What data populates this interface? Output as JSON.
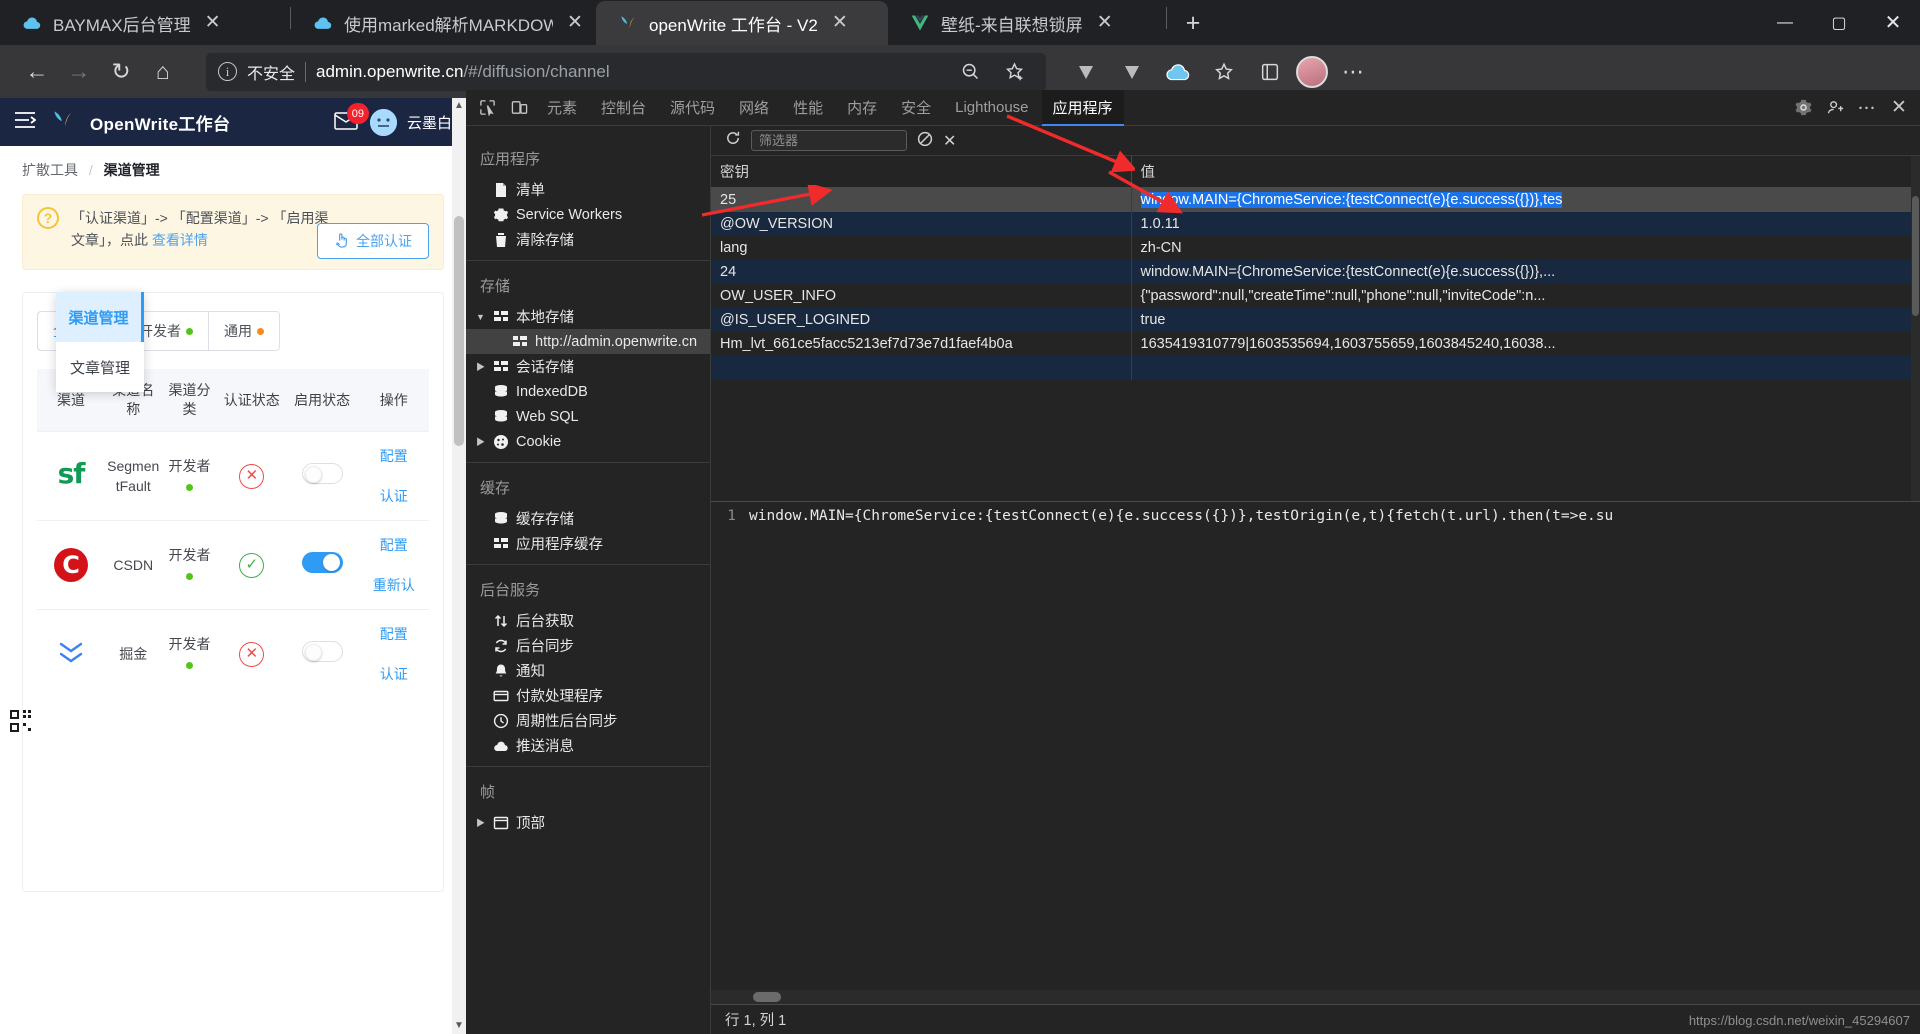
{
  "browser": {
    "tabs": [
      {
        "title": "BAYMAX后台管理",
        "favicon": "cloud-icon",
        "active": false,
        "close_label": "✕"
      },
      {
        "title": "使用marked解析MARKDOWN,生",
        "favicon": "cloud-icon",
        "active": false,
        "close_label": "✕"
      },
      {
        "title": "openWrite 工作台 - V2",
        "favicon": "openwrite-icon",
        "active": true,
        "close_label": "✕"
      },
      {
        "title": "壁纸-来自联想锁屏",
        "favicon": "vue-icon",
        "active": false,
        "close_label": "✕"
      }
    ],
    "new_tab_label": "+",
    "window_controls": {
      "minimize": "—",
      "maximize": "▢",
      "close": "✕"
    },
    "toolbar": {
      "back": "←",
      "forward": "→",
      "reload": "↻",
      "home": "⌂",
      "security_label": "不安全",
      "url_host": "admin.openwrite.cn",
      "url_path": "/#/diffusion/channel",
      "zoom_out_icon": "zoom-out-icon",
      "favorite_icon": "star-add-icon",
      "collections_icon": "collections-icon",
      "settings_icon": "more-icon"
    }
  },
  "app": {
    "header": {
      "menu_icon": "hamburger-icon",
      "logo_icon": "openwrite-logo",
      "title": "OpenWrite工作台",
      "mail_icon": "mail-icon",
      "badge_count": "09",
      "avatar_icon": "user-avatar",
      "user_name": "云墨白"
    },
    "breadcrumb": {
      "parent": "扩散工具",
      "separator": "/",
      "current": "渠道管理"
    },
    "alert": {
      "icon": "question-icon",
      "line1": "「认证渠道」-> 「配置渠道」-> 「启用渠",
      "line2": "文章」，点此",
      "link": "查看详情",
      "button_icon": "hand-click-icon",
      "button_label": "全部认证"
    },
    "dropdown": {
      "items": [
        {
          "label": "渠道管理",
          "active": true
        },
        {
          "label": "文章管理",
          "active": false
        }
      ]
    },
    "tabs": [
      {
        "label": "全部渠道",
        "active": true,
        "dot": null
      },
      {
        "label": "开发者",
        "active": false,
        "dot": "#52c41a"
      },
      {
        "label": "通用",
        "active": false,
        "dot": "#fa8c16"
      }
    ],
    "table": {
      "columns": [
        "渠道",
        "渠道名称",
        "渠道分类",
        "认证状态",
        "启用状态",
        "操作"
      ],
      "rows": [
        {
          "logo": "segmentfault-logo",
          "logo_text": "sf",
          "name": "SegmentFault",
          "category": "开发者",
          "category_dot": "#52c41a",
          "cert": "failed",
          "cert_icon": "✕",
          "enabled": false,
          "actions": [
            "配置",
            "认证"
          ]
        },
        {
          "logo": "csdn-logo",
          "logo_text": "C",
          "name": "CSDN",
          "category": "开发者",
          "category_dot": "#52c41a",
          "cert": "ok",
          "cert_icon": "✓",
          "enabled": true,
          "actions": [
            "配置",
            "重新认"
          ]
        },
        {
          "logo": "juejin-logo",
          "logo_text": "≫",
          "name": "掘金",
          "category": "开发者",
          "category_dot": "#52c41a",
          "cert": "failed",
          "cert_icon": "✕",
          "enabled": false,
          "actions": [
            "配置",
            "认证"
          ]
        }
      ]
    },
    "qr_icon": "qr-code-icon"
  },
  "devtools": {
    "left_icons": [
      "inspect-icon",
      "device-toolbar-icon"
    ],
    "tabs": [
      {
        "label": "元素",
        "active": false
      },
      {
        "label": "控制台",
        "active": false
      },
      {
        "label": "源代码",
        "active": false
      },
      {
        "label": "网络",
        "active": false
      },
      {
        "label": "性能",
        "active": false
      },
      {
        "label": "内存",
        "active": false
      },
      {
        "label": "安全",
        "active": false
      },
      {
        "label": "Lighthouse",
        "active": false
      },
      {
        "label": "应用程序",
        "active": true
      }
    ],
    "right_icons": [
      "gear-icon",
      "devices-icon",
      "more-vertical-icon",
      "close-icon"
    ],
    "sidebar": {
      "groups": [
        {
          "title": "应用程序",
          "nodes": [
            {
              "label": "清单",
              "icon": "manifest-file-icon",
              "arrow": null,
              "indent": false,
              "selected": false
            },
            {
              "label": "Service Workers",
              "icon": "gear-icon",
              "arrow": null,
              "indent": false,
              "selected": false
            },
            {
              "label": "清除存储",
              "icon": "trash-icon",
              "arrow": null,
              "indent": false,
              "selected": false
            }
          ]
        },
        {
          "title": "存储",
          "nodes": [
            {
              "label": "本地存储",
              "icon": "table-icon",
              "arrow": "down",
              "indent": false,
              "selected": false
            },
            {
              "label": "http://admin.openwrite.cn",
              "icon": "table-icon",
              "arrow": null,
              "indent": true,
              "selected": true
            },
            {
              "label": "会话存储",
              "icon": "table-icon",
              "arrow": "right",
              "indent": false,
              "selected": false
            },
            {
              "label": "IndexedDB",
              "icon": "database-icon",
              "arrow": null,
              "indent": false,
              "selected": false
            },
            {
              "label": "Web SQL",
              "icon": "database-icon",
              "arrow": null,
              "indent": false,
              "selected": false
            },
            {
              "label": "Cookie",
              "icon": "cookie-icon",
              "arrow": "right",
              "indent": false,
              "selected": false
            }
          ]
        },
        {
          "title": "缓存",
          "nodes": [
            {
              "label": "缓存存储",
              "icon": "database-icon",
              "arrow": null,
              "indent": false,
              "selected": false
            },
            {
              "label": "应用程序缓存",
              "icon": "table-icon",
              "arrow": null,
              "indent": false,
              "selected": false
            }
          ]
        },
        {
          "title": "后台服务",
          "nodes": [
            {
              "label": "后台获取",
              "icon": "arrows-updown-icon",
              "arrow": null,
              "indent": false,
              "selected": false
            },
            {
              "label": "后台同步",
              "icon": "sync-icon",
              "arrow": null,
              "indent": false,
              "selected": false
            },
            {
              "label": "通知",
              "icon": "bell-icon",
              "arrow": null,
              "indent": false,
              "selected": false
            },
            {
              "label": "付款处理程序",
              "icon": "card-icon",
              "arrow": null,
              "indent": false,
              "selected": false
            },
            {
              "label": "周期性后台同步",
              "icon": "clock-icon",
              "arrow": null,
              "indent": false,
              "selected": false
            },
            {
              "label": "推送消息",
              "icon": "cloud-icon",
              "arrow": null,
              "indent": false,
              "selected": false
            }
          ]
        },
        {
          "title": "帧",
          "nodes": [
            {
              "label": "顶部",
              "icon": "frame-icon",
              "arrow": "right",
              "indent": false,
              "selected": false
            }
          ]
        }
      ]
    },
    "storage_toolbar": {
      "refresh_icon": "refresh-icon",
      "filter_placeholder": "筛选器",
      "filter_value": "",
      "clear_all_icon": "no-entry-icon",
      "delete_icon": "delete-x-icon"
    },
    "storage_table": {
      "columns": [
        "密钥",
        "值"
      ],
      "rows": [
        {
          "key": "25",
          "value": "window.MAIN={ChromeService:{testConnect(e){e.success({})},tes",
          "selected": true
        },
        {
          "key": "@OW_VERSION",
          "value": "1.0.11",
          "selected": false
        },
        {
          "key": "lang",
          "value": "zh-CN",
          "selected": false
        },
        {
          "key": "24",
          "value": "window.MAIN={ChromeService:{testConnect(e){e.success({})},...",
          "selected": false
        },
        {
          "key": "OW_USER_INFO",
          "value": "{\"password\":null,\"createTime\":null,\"phone\":null,\"inviteCode\":n...",
          "selected": false
        },
        {
          "key": "@IS_USER_LOGINED",
          "value": "true",
          "selected": false
        },
        {
          "key": "Hm_lvt_661ce5facc5213ef7d73e7d1faef4b0a",
          "value": "1635419310779|1603535694,1603755659,1603845240,16038...",
          "selected": false
        },
        {
          "key": "",
          "value": "",
          "selected": false
        }
      ]
    },
    "preview": {
      "line_number": "1",
      "code": "window.MAIN={ChromeService:{testConnect(e){e.success({})},testOrigin(e,t){fetch(t.url).then(t=>e.su",
      "status": "行 1, 列 1"
    },
    "watermark": "https://blog.csdn.net/weixin_45294607"
  }
}
